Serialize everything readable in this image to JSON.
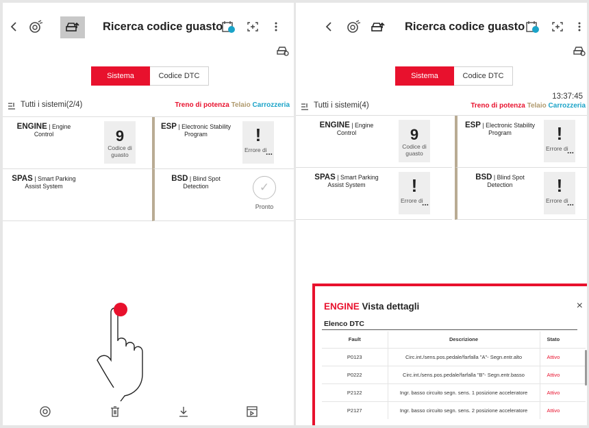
{
  "app": {
    "title": "Ricerca codice guasto"
  },
  "tabs": {
    "sistema": "Sistema",
    "codice_dtc": "Codice DTC"
  },
  "left_panel": {
    "all_systems_label": "Tutti i sistemi(2/4)"
  },
  "right_panel": {
    "all_systems_label": "Tutti i sistemi(4)",
    "timestamp": "13:37:45"
  },
  "filters": {
    "powertrain": "Treno di potenza",
    "chassis": "Telaio",
    "body": "Carrozzeria",
    "colors": {
      "powertrain": "#e8112d",
      "chassis": "#b09a6e",
      "body": "#1aa3c8"
    }
  },
  "systems": {
    "engine": {
      "code": "ENGINE",
      "name": "Engine Control"
    },
    "esp": {
      "code": "ESP",
      "name": "Electronic Stability Program"
    },
    "spas": {
      "code": "SPAS",
      "name": "Smart Parking Assist System"
    },
    "bsd": {
      "code": "BSD",
      "name": "Blind Spot Detection"
    }
  },
  "statuses": {
    "fault_count": "9",
    "fault_label": "Codice di guasto",
    "error_mark": "!",
    "error_label": "Errore di",
    "more": "...",
    "ready_label": "Pronto"
  },
  "details": {
    "brand": "ENGINE",
    "title": "Vista dettagli",
    "close": "×",
    "list_title": "Elenco DTC",
    "columns": [
      "Fault",
      "Descrizione",
      "Stato"
    ],
    "rows": [
      {
        "fault": "P0123",
        "description": "Circ.int./sens.pos.pedale/farfalla \"A\"- Segn.entr.alto",
        "status": "Attivo"
      },
      {
        "fault": "P0222",
        "description": "Circ.int./sens.pos.pedale/farfalla \"B\"- Segn.entr.basso",
        "status": "Attivo"
      },
      {
        "fault": "P2122",
        "description": "Ingr. basso circuito segn. sens. 1 posizione acceleratore",
        "status": "Attivo"
      },
      {
        "fault": "P2127",
        "description": "Ingr. basso circuito segn. sens. 2 posizione acceleratore",
        "status": "Attivo"
      }
    ]
  },
  "icons": {
    "back": "chevron-left-icon",
    "vci": "vci-connection-icon",
    "vehicle": "vehicle-upload-icon",
    "calendar": "calendar-icon",
    "expand": "expand-icon",
    "menu": "more-vertical-icon",
    "car_settings": "car-settings-icon",
    "filter": "filter-list-icon",
    "home": "home-icon",
    "delete": "trash-icon",
    "download": "download-icon",
    "export": "export-icon"
  },
  "colors": {
    "accent": "#e8112d",
    "highlight_border": "#e8112d"
  }
}
